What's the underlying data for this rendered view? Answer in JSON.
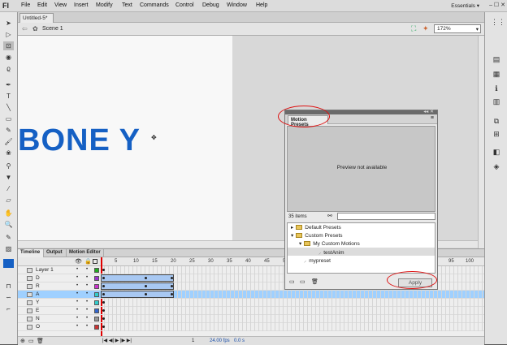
{
  "app": {
    "logo": "Fl",
    "workspace": "Essentials ▾"
  },
  "menu": [
    "File",
    "Edit",
    "View",
    "Insert",
    "Modify",
    "Text",
    "Commands",
    "Control",
    "Debug",
    "Window",
    "Help"
  ],
  "window_controls": "–  ☐  ✕",
  "document": {
    "tab": "Untitled-5*",
    "scene": "Scene 1",
    "zoom": "172%"
  },
  "stage": {
    "text": "BONE Y"
  },
  "timeline": {
    "tabs": [
      "Timeline",
      "Output",
      "Motion Editor"
    ],
    "frame_numbers": [
      "5",
      "10",
      "15",
      "20",
      "25",
      "30",
      "35",
      "40",
      "45",
      "50",
      "55",
      "60",
      "65",
      "70",
      "75",
      "80",
      "85",
      "90",
      "95",
      "100"
    ],
    "layers": [
      {
        "name": "Layer 1",
        "color": "#22aa22",
        "tween": false
      },
      {
        "name": "D",
        "color": "#9933cc",
        "tween": true
      },
      {
        "name": "R",
        "color": "#cc33cc",
        "tween": true
      },
      {
        "name": "A",
        "color": "#33cccc",
        "tween": true,
        "selected": true
      },
      {
        "name": "Y",
        "color": "#33cccc",
        "tween": false
      },
      {
        "name": "E",
        "color": "#3366cc",
        "tween": false
      },
      {
        "name": "N",
        "color": "#999999",
        "tween": false
      },
      {
        "name": "O",
        "color": "#cc3333",
        "tween": false
      }
    ],
    "footer_fps": "24.00 fps",
    "footer_time": "0.0 s",
    "footer_frame": "1"
  },
  "motion_presets": {
    "title": "Motion Presets",
    "preview": "Preview not available",
    "count": "35 items",
    "tree": [
      {
        "label": "Default Presets",
        "level": 0,
        "type": "folder"
      },
      {
        "label": "Custom Presets",
        "level": 0,
        "type": "folder"
      },
      {
        "label": "My Custom Motions",
        "level": 1,
        "type": "folder"
      },
      {
        "label": "testAnim",
        "level": 2,
        "type": "preset",
        "selected": true
      },
      {
        "label": "mypreset",
        "level": 1,
        "type": "preset"
      }
    ],
    "apply": "Apply"
  }
}
